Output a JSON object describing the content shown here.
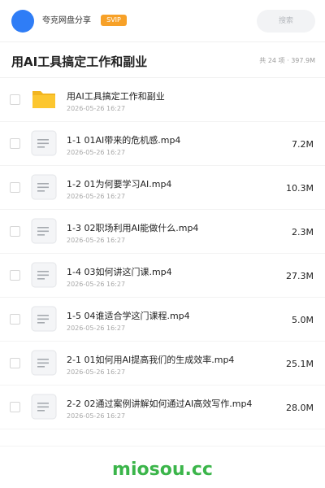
{
  "header": {
    "share_name": "夸克网盘分享",
    "vip_label": "SVIP",
    "search_placeholder": "搜索"
  },
  "folder": {
    "title": "用AI工具搞定工作和副业",
    "summary": "共 24 项 · 397.9M"
  },
  "items": [
    {
      "type": "folder",
      "name": "用AI工具搞定工作和副业",
      "date": "2026-05-26 16:27",
      "size": ""
    },
    {
      "type": "file",
      "name": "1-1 01AI带来的危机感.mp4",
      "date": "2026-05-26 16:27",
      "size": "7.2M"
    },
    {
      "type": "file",
      "name": "1-2 01为何要学习AI.mp4",
      "date": "2026-05-26 16:27",
      "size": "10.3M"
    },
    {
      "type": "file",
      "name": "1-3 02职场利用AI能做什么.mp4",
      "date": "2026-05-26 16:27",
      "size": "2.3M"
    },
    {
      "type": "file",
      "name": "1-4 03如何讲这门课.mp4",
      "date": "2026-05-26 16:27",
      "size": "27.3M"
    },
    {
      "type": "file",
      "name": "1-5 04谁适合学这门课程.mp4",
      "date": "2026-05-26 16:27",
      "size": "5.0M"
    },
    {
      "type": "file",
      "name": "2-1 01如何用AI提高我们的生成效率.mp4",
      "date": "2026-05-26 16:27",
      "size": "25.1M"
    },
    {
      "type": "file",
      "name": "2-2 02通过案例讲解如何通过AI高效写作.mp4",
      "date": "2026-05-26 16:27",
      "size": "28.0M"
    }
  ],
  "icons": {
    "folder": "folder-icon",
    "file": "document-icon"
  },
  "colors": {
    "accent": "#2f7df6",
    "vip": "#f7a128",
    "folder": "#fcc62f",
    "watermark": "#3bb54a"
  },
  "watermark": "miosou.cc"
}
